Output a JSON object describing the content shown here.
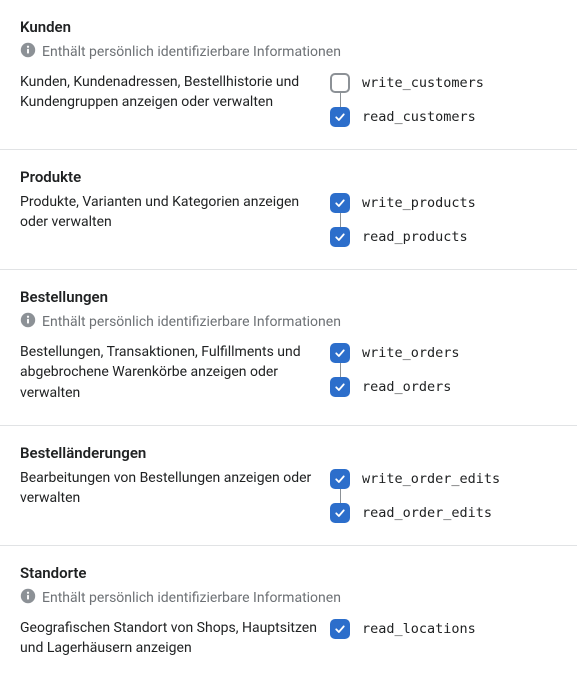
{
  "pii_label": "Enthält persönlich identifizierbare Informationen",
  "sections": [
    {
      "title": "Kunden",
      "has_pii": true,
      "description": "Kunden, Kundenadressen, Bestellhistorie und Kundengruppen anzeigen oder verwalten",
      "permissions": [
        {
          "name": "write_customers",
          "checked": false
        },
        {
          "name": "read_customers",
          "checked": true
        }
      ]
    },
    {
      "title": "Produkte",
      "has_pii": false,
      "description": "Produkte, Varianten und Kategorien anzeigen oder verwalten",
      "permissions": [
        {
          "name": "write_products",
          "checked": true
        },
        {
          "name": "read_products",
          "checked": true
        }
      ]
    },
    {
      "title": "Bestellungen",
      "has_pii": true,
      "description": "Bestellungen, Transaktionen, Fulfillments und abgebrochene Warenkörbe anzeigen oder verwalten",
      "permissions": [
        {
          "name": "write_orders",
          "checked": true
        },
        {
          "name": "read_orders",
          "checked": true
        }
      ]
    },
    {
      "title": "Bestelländerungen",
      "has_pii": false,
      "description": "Bearbeitungen von Bestellungen anzeigen oder verwalten",
      "permissions": [
        {
          "name": "write_order_edits",
          "checked": true
        },
        {
          "name": "read_order_edits",
          "checked": true
        }
      ]
    },
    {
      "title": "Standorte",
      "has_pii": true,
      "description": "Geografischen Standort von Shops, Hauptsitzen und Lagerhäusern anzeigen",
      "permissions": [
        {
          "name": "read_locations",
          "checked": true
        }
      ]
    }
  ]
}
